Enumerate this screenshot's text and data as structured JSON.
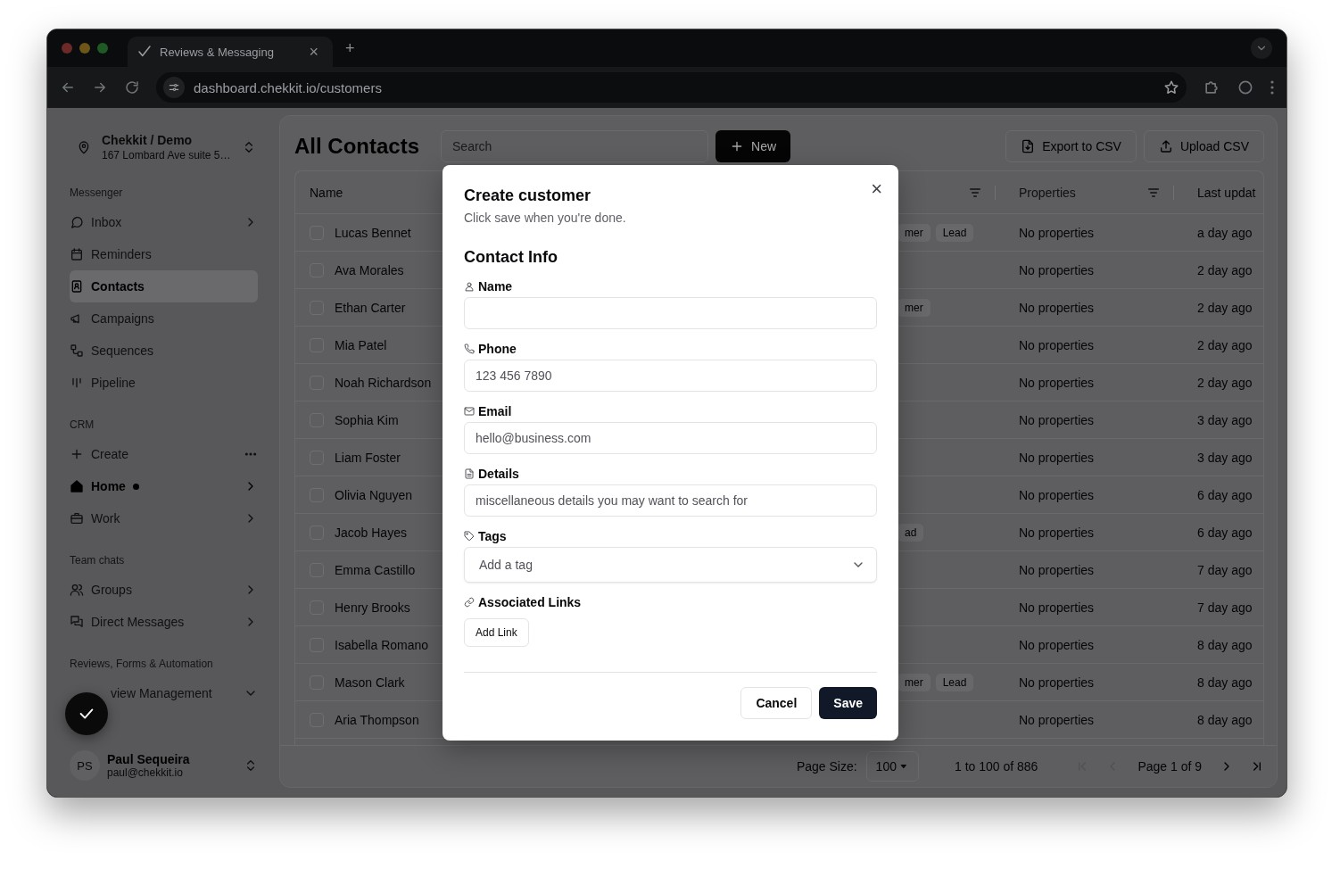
{
  "browser": {
    "tab_title": "Reviews & Messaging",
    "tab_close": "×",
    "new_tab": "+",
    "url": "dashboard.chekkit.io/customers"
  },
  "sidebar": {
    "workspace": {
      "name": "Chekkit / Demo",
      "address": "167 Lombard Ave suite 5…"
    },
    "sections": [
      {
        "title": "Messenger",
        "items": [
          {
            "label": "Inbox",
            "selected": false,
            "unread": false
          },
          {
            "label": "Reminders",
            "selected": false,
            "unread": false
          },
          {
            "label": "Contacts",
            "selected": true,
            "unread": false
          },
          {
            "label": "Campaigns",
            "selected": false,
            "unread": false
          },
          {
            "label": "Sequences",
            "selected": false,
            "unread": false
          },
          {
            "label": "Pipeline",
            "selected": false,
            "unread": false
          }
        ]
      },
      {
        "title": "CRM",
        "items": [
          {
            "label": "Create",
            "selected": false,
            "unread": false
          },
          {
            "label": "Home",
            "selected": false,
            "unread": true
          },
          {
            "label": "Work",
            "selected": false,
            "unread": false
          }
        ]
      },
      {
        "title": "Team chats",
        "items": [
          {
            "label": "Groups",
            "selected": false,
            "unread": false
          },
          {
            "label": "Direct Messages",
            "selected": false,
            "unread": false
          }
        ]
      },
      {
        "title": "Reviews, Forms & Automation",
        "items": [
          {
            "label": "view Management",
            "selected": false,
            "unread": false
          }
        ]
      }
    ],
    "user": {
      "initials": "PS",
      "name": "Paul Sequeira",
      "email": "paul@chekkit.io"
    }
  },
  "header": {
    "title": "All Contacts",
    "search_placeholder": "Search",
    "new_button": "New",
    "export_button": "Export to CSV",
    "upload_button": "Upload CSV"
  },
  "table": {
    "columns": [
      "Name",
      "Properties",
      "Last updat"
    ],
    "rows": [
      {
        "name": "Lucas Bennet",
        "checked": false,
        "tags": [
          "mer",
          "Lead"
        ],
        "properties": "No properties",
        "updated": "a day ago"
      },
      {
        "name": "Ava Morales",
        "checked": false,
        "tags": [],
        "properties": "No properties",
        "updated": "2 day ago"
      },
      {
        "name": "Ethan Carter",
        "checked": false,
        "tags": [
          "mer"
        ],
        "properties": "No properties",
        "updated": "2 day ago"
      },
      {
        "name": "Mia Patel",
        "checked": false,
        "tags": [],
        "properties": "No properties",
        "updated": "2 day ago"
      },
      {
        "name": "Noah Richardson",
        "checked": false,
        "tags": [],
        "properties": "No properties",
        "updated": "2 day ago"
      },
      {
        "name": "Sophia Kim",
        "checked": false,
        "tags": [],
        "properties": "No properties",
        "updated": "3 day ago"
      },
      {
        "name": "Liam Foster",
        "checked": false,
        "tags": [],
        "properties": "No properties",
        "updated": "3 day ago"
      },
      {
        "name": "Olivia Nguyen",
        "checked": false,
        "tags": [],
        "properties": "No properties",
        "updated": "6 day ago"
      },
      {
        "name": "Jacob Hayes",
        "checked": false,
        "tags": [
          "ad"
        ],
        "properties": "No properties",
        "updated": "6 day ago"
      },
      {
        "name": "Emma Castillo",
        "checked": false,
        "tags": [],
        "properties": "No properties",
        "updated": "7 day ago"
      },
      {
        "name": "Henry Brooks",
        "checked": false,
        "tags": [],
        "properties": "No properties",
        "updated": "7 day ago"
      },
      {
        "name": "Isabella Romano",
        "checked": false,
        "tags": [],
        "properties": "No properties",
        "updated": "8 day ago"
      },
      {
        "name": "Mason Clark",
        "checked": false,
        "tags": [
          "mer",
          "Lead"
        ],
        "properties": "No properties",
        "updated": "8 day ago"
      },
      {
        "name": "Aria Thompson",
        "checked": false,
        "tags": [],
        "properties": "No properties",
        "updated": "8 day ago"
      }
    ]
  },
  "pagination": {
    "page_size_label": "Page Size:",
    "page_size": "100",
    "range": "1 to 100 of 886",
    "page": "Page 1 of 9",
    "nav": [
      {
        "kind": "first",
        "disabled": true
      },
      {
        "kind": "prev",
        "disabled": true
      },
      {
        "kind": "next",
        "disabled": false
      },
      {
        "kind": "last",
        "disabled": false
      }
    ]
  },
  "dialog": {
    "title": "Create customer",
    "subtitle": "Click save when you're done.",
    "close": "×",
    "section": "Contact Info",
    "fields": [
      {
        "kind": "text",
        "label": "Name"
      },
      {
        "kind": "text",
        "label": "Phone",
        "placeholder": "123 456 7890"
      },
      {
        "kind": "text",
        "label": "Email",
        "placeholder": "hello@business.com"
      },
      {
        "kind": "text",
        "label": "Details",
        "placeholder": "miscellaneous details you may want to search for"
      },
      {
        "kind": "select",
        "label": "Tags",
        "placeholder": "Add a tag"
      },
      {
        "kind": "links",
        "label": "Associated Links",
        "button": "Add Link"
      }
    ],
    "cancel": "Cancel",
    "save": "Save"
  }
}
